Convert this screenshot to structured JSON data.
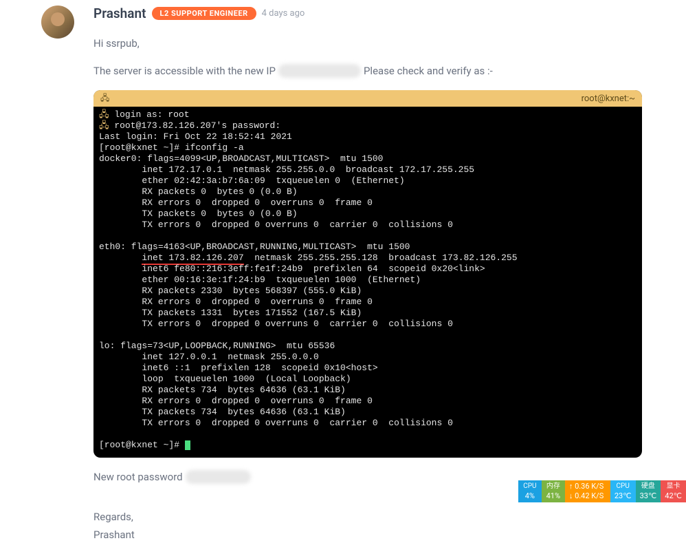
{
  "post": {
    "author": "Prashant",
    "role_badge": "L2 SUPPORT ENGINEER",
    "timestamp": "4 days ago",
    "greeting": "Hi ssrpub,",
    "line2_before": "The server is accessible with the new IP",
    "line2_after": "Please check and verify as :-",
    "new_root_pw_label": "New root password",
    "regards": "Regards,",
    "signature": "Prashant"
  },
  "terminal": {
    "title": "root@kxnet:~",
    "lines": {
      "l1a": "login as: root",
      "l1b": "root@173.82.126.207's password:",
      "l2": "Last login: Fri Oct 22 18:52:41 2021",
      "l3": "[root@kxnet ~]# ifconfig -a",
      "d0a": "docker0: flags=4099<UP,BROADCAST,MULTICAST>  mtu 1500",
      "d0b": "        inet 172.17.0.1  netmask 255.255.0.0  broadcast 172.17.255.255",
      "d0c": "        ether 02:42:3a:b7:6a:09  txqueuelen 0  (Ethernet)",
      "d0d": "        RX packets 0  bytes 0 (0.0 B)",
      "d0e": "        RX errors 0  dropped 0  overruns 0  frame 0",
      "d0f": "        TX packets 0  bytes 0 (0.0 B)",
      "d0g": "        TX errors 0  dropped 0 overruns 0  carrier 0  collisions 0",
      "e0a": "eth0: flags=4163<UP,BROADCAST,RUNNING,MULTICAST>  mtu 1500",
      "e0b_pre": "        ",
      "e0b_hl": "inet 173.82.126.207",
      "e0b_post": "  netmask 255.255.255.128  broadcast 173.82.126.255",
      "e0c": "        inet6 fe80::216:3eff:fe1f:24b9  prefixlen 64  scopeid 0x20<link>",
      "e0d": "        ether 00:16:3e:1f:24:b9  txqueuelen 1000  (Ethernet)",
      "e0e": "        RX packets 2330  bytes 568397 (555.0 KiB)",
      "e0f": "        RX errors 0  dropped 0  overruns 0  frame 0",
      "e0g": "        TX packets 1331  bytes 171552 (167.5 KiB)",
      "e0h": "        TX errors 0  dropped 0 overruns 0  carrier 0  collisions 0",
      "loa": "lo: flags=73<UP,LOOPBACK,RUNNING>  mtu 65536",
      "lob": "        inet 127.0.0.1  netmask 255.0.0.0",
      "loc": "        inet6 ::1  prefixlen 128  scopeid 0x10<host>",
      "lod": "        loop  txqueuelen 1000  (Local Loopback)",
      "loe": "        RX packets 734  bytes 64636 (63.1 KiB)",
      "lof": "        RX errors 0  dropped 0  overruns 0  frame 0",
      "log": "        TX packets 734  bytes 64636 (63.1 KiB)",
      "loh": "        TX errors 0  dropped 0 overruns 0  carrier 0  collisions 0",
      "prompt": "[root@kxnet ~]# "
    }
  },
  "sysmon": {
    "cpu_label": "CPU",
    "cpu_value": "4%",
    "mem_label": "内存",
    "mem_value": "41%",
    "net_up": "0.36 K/S",
    "net_down": "0.42 K/S",
    "cpu2_label": "CPU",
    "cpu2_value": "23℃",
    "disk_label": "硬盘",
    "disk_value": "33℃",
    "gpu_label": "显卡",
    "gpu_value": "42℃"
  }
}
